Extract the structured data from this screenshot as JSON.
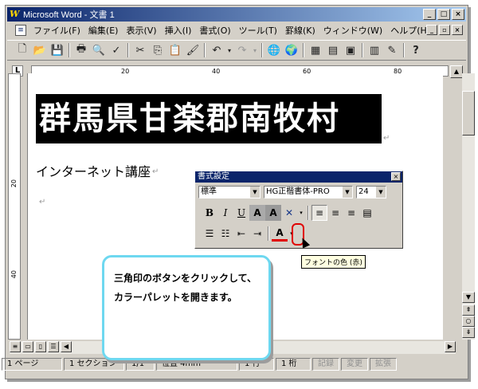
{
  "window": {
    "title": "Microsoft Word - 文書 1"
  },
  "menu": [
    "ファイル(F)",
    "編集(E)",
    "表示(V)",
    "挿入(I)",
    "書式(O)",
    "ツール(T)",
    "罫線(K)",
    "ウィンドウ(W)",
    "ヘルプ(H)"
  ],
  "ruler": {
    "ticks": [
      "20",
      "40",
      "60",
      "80"
    ]
  },
  "vruler": {
    "ticks": [
      "20",
      "40"
    ]
  },
  "document": {
    "headline": "群馬県甘楽郡南牧村",
    "line2": "インターネット講座"
  },
  "format_toolbar": {
    "title": "書式設定",
    "style": "標準",
    "font": "HG正楷書体-PRO",
    "size": "24"
  },
  "tooltip": "フォントの色 (赤)",
  "callout": {
    "line1": "三角印のボタンをクリックして、",
    "line2": "カラーパレットを開きます。"
  },
  "status": {
    "page": "1 ページ",
    "section": "1 セクション",
    "pages": "1/1",
    "position": "位置 4mm",
    "line": "1 行",
    "col": "1 桁",
    "rec": "記録",
    "change": "変更",
    "ext": "拡張"
  },
  "colors": {
    "titlebar": "#0a246a",
    "callout_border": "#6ed8f0",
    "ring": "#e00000",
    "font_color_underline": "#e00000"
  }
}
